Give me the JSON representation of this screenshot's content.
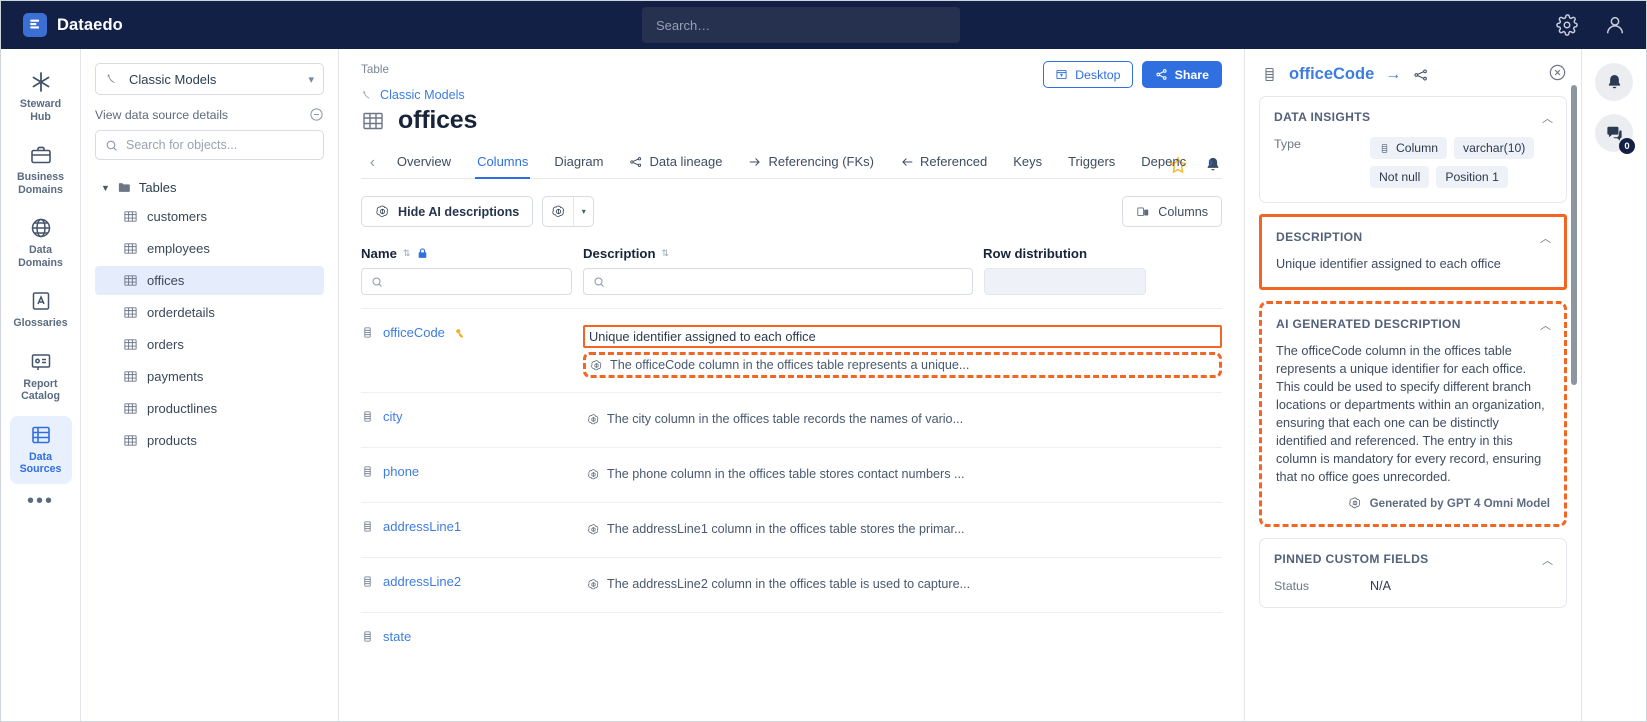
{
  "topbar": {
    "brand": "Dataedo",
    "search_placeholder": "Search…",
    "settings_icon": "gear-icon",
    "account_icon": "user-icon"
  },
  "left_rail": {
    "items": [
      {
        "label": "Steward Hub",
        "icon": "asterisk-icon",
        "active": false
      },
      {
        "label": "Business Domains",
        "icon": "briefcase-icon",
        "active": false
      },
      {
        "label": "Data Domains",
        "icon": "globe-icon",
        "active": false
      },
      {
        "label": "Glossaries",
        "icon": "glossary-icon",
        "active": false
      },
      {
        "label": "Report Catalog",
        "icon": "report-icon",
        "active": false
      },
      {
        "label": "Data Sources",
        "icon": "database-rows-icon",
        "active": true
      }
    ],
    "more": "•••"
  },
  "tree_panel": {
    "datasource": "Classic Models",
    "details_link": "View data source details",
    "search_placeholder": "Search for objects...",
    "folder": "Tables",
    "nodes": [
      {
        "label": "customers",
        "selected": false
      },
      {
        "label": "employees",
        "selected": false
      },
      {
        "label": "offices",
        "selected": true
      },
      {
        "label": "orderdetails",
        "selected": false
      },
      {
        "label": "orders",
        "selected": false
      },
      {
        "label": "payments",
        "selected": false
      },
      {
        "label": "productlines",
        "selected": false
      },
      {
        "label": "products",
        "selected": false
      }
    ]
  },
  "main": {
    "kicker": "Table",
    "breadcrumb": "Classic Models",
    "title": "offices",
    "desktop_button": "Desktop",
    "share_button": "Share",
    "tabs": [
      {
        "label": "Overview",
        "active": false,
        "icon": null
      },
      {
        "label": "Columns",
        "active": true,
        "icon": null
      },
      {
        "label": "Diagram",
        "active": false,
        "icon": null
      },
      {
        "label": "Data lineage",
        "active": false,
        "icon": "lineage-icon"
      },
      {
        "label": "Referencing (FKs)",
        "active": false,
        "icon": "arrow-out-icon"
      },
      {
        "label": "Referenced",
        "active": false,
        "icon": "arrow-in-icon"
      },
      {
        "label": "Keys",
        "active": false,
        "icon": null
      },
      {
        "label": "Triggers",
        "active": false,
        "icon": null
      },
      {
        "label": "Depenc",
        "active": false,
        "icon": null
      }
    ],
    "toolbar": {
      "hide_ai_button": "Hide AI descriptions",
      "ai_icon": "openai-icon",
      "dropdown_caret": "▾",
      "columns_button": "Columns"
    },
    "grid": {
      "headers": {
        "name": "Name",
        "description": "Description",
        "row_distribution": "Row distribution"
      },
      "rows": [
        {
          "name": "officeCode",
          "is_key": true,
          "description": "Unique identifier assigned to each office",
          "ai_description": "The officeCode column in the offices table represents a unique...",
          "highlighted": true
        },
        {
          "name": "city",
          "is_key": false,
          "description": null,
          "ai_description": "The city column in the offices table records the names of vario...",
          "highlighted": false
        },
        {
          "name": "phone",
          "is_key": false,
          "description": null,
          "ai_description": "The phone column in the offices table stores contact numbers ...",
          "highlighted": false
        },
        {
          "name": "addressLine1",
          "is_key": false,
          "description": null,
          "ai_description": "The addressLine1 column in the offices table stores the primar...",
          "highlighted": false
        },
        {
          "name": "addressLine2",
          "is_key": false,
          "description": null,
          "ai_description": "The addressLine2 column in the offices table is used to capture...",
          "highlighted": false
        },
        {
          "name": "state",
          "is_key": false,
          "description": null,
          "ai_description": null,
          "highlighted": false
        }
      ]
    }
  },
  "detail_panel": {
    "title": "officeCode",
    "arrow": "→",
    "lineage_icon": "lineage-icon",
    "close_icon": "close-circle-icon",
    "data_insights": {
      "title": "DATA INSIGHTS",
      "type_label": "Type",
      "pills": [
        "Column",
        "varchar(10)",
        "Not null",
        "Position 1"
      ]
    },
    "description": {
      "title": "DESCRIPTION",
      "text": "Unique identifier assigned to each office"
    },
    "ai_description": {
      "title": "AI GENERATED DESCRIPTION",
      "text": "The officeCode column in the offices table represents a unique identifier for each office. This could be used to specify different branch locations or departments within an organization, ensuring that each one can be distinctly identified and referenced. The entry in this column is mandatory for every record, ensuring that no office goes unrecorded.",
      "generated_by": "Generated by GPT 4 Omni Model"
    },
    "pinned_custom_fields": {
      "title": "PINNED CUSTOM FIELDS",
      "status_label": "Status",
      "status_value": "N/A"
    }
  },
  "right_rail": {
    "notifications_icon": "bell-icon",
    "chat_icon": "chat-icon",
    "chat_badge": "0"
  },
  "colors": {
    "topbar": "#132046",
    "accent": "#2f6fe0",
    "highlight": "#f26522",
    "link": "#3d7de0"
  }
}
